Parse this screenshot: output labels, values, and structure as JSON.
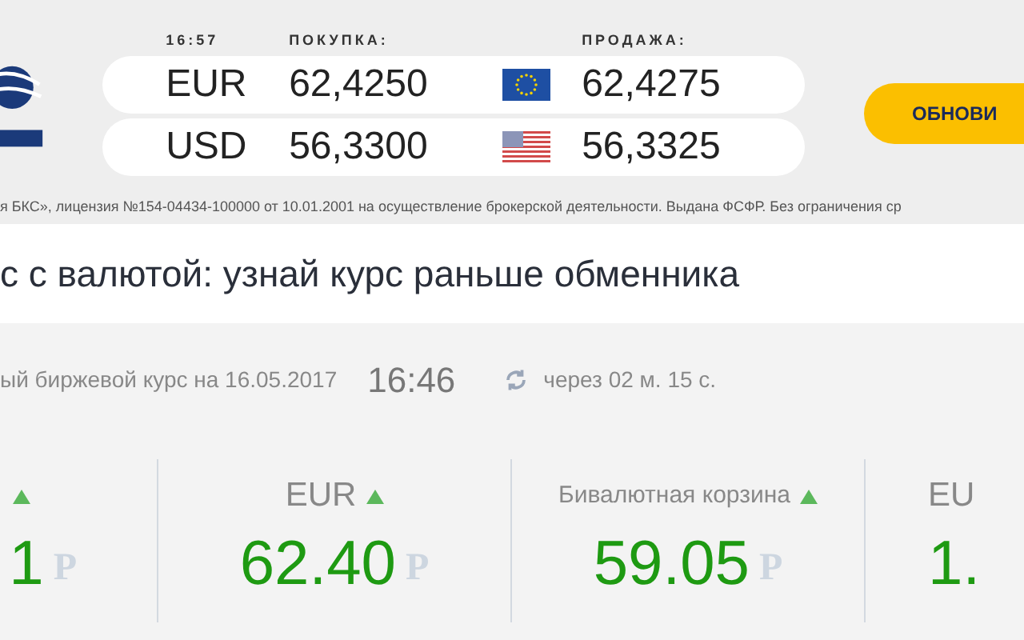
{
  "rates": {
    "time": "16:57",
    "buy_header": "ПОКУПКА:",
    "sell_header": "ПРОДАЖА:",
    "rows": [
      {
        "currency": "EUR",
        "buy": "62,4250",
        "sell": "62,4275"
      },
      {
        "currency": "USD",
        "buy": "56,3300",
        "sell": "56,3325"
      }
    ]
  },
  "refresh_button": "ОБНОВИ",
  "disclaimer": "я БКС», лицензия №154-04434-100000 от 10.01.2001 на осуществление брокерской деятельности. Выдана ФСФР. Без ограничения ср",
  "heading": "с с валютой: узнай курс раньше обменника",
  "exchange": {
    "label": "ый биржевой курс на 16.05.2017",
    "time": "16:46",
    "countdown": "через 02 м. 15 с."
  },
  "quotes": [
    {
      "rising": true,
      "value": "1",
      "currency_sign": "Р"
    },
    {
      "label": "EUR",
      "rising": true,
      "value": "62.40",
      "currency_sign": "Р"
    },
    {
      "label": "Бивалютная корзина",
      "rising": true,
      "value": "59.05",
      "currency_sign": "Р"
    },
    {
      "label": "EU",
      "value": "1."
    }
  ]
}
